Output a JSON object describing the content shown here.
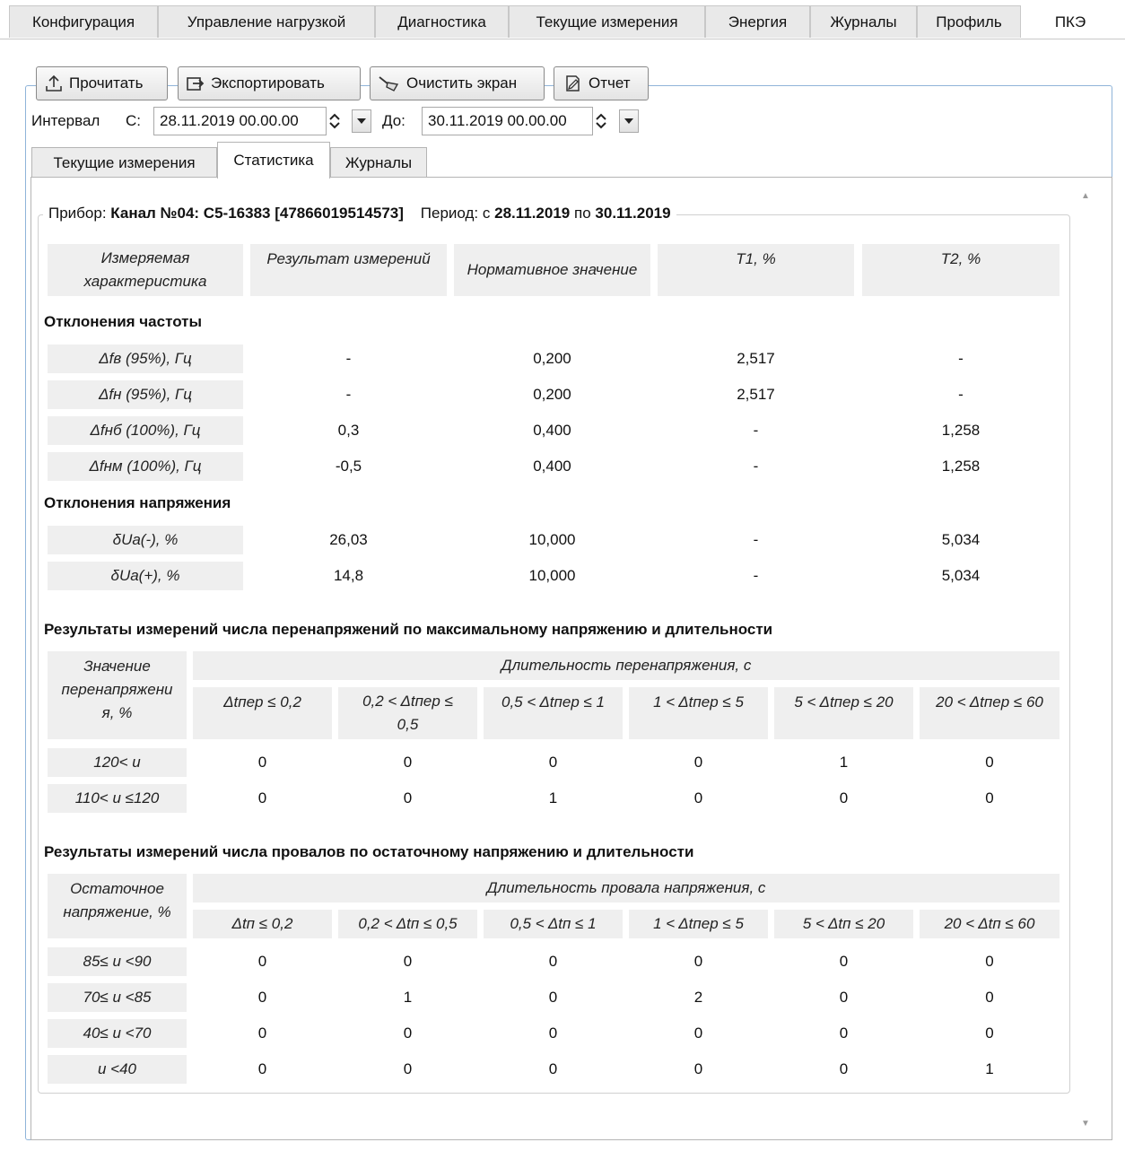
{
  "top_tabs": [
    "Конфигурация",
    "Управление нагрузкой",
    "Диагностика",
    "Текущие измерения",
    "Энергия",
    "Журналы",
    "Профиль",
    "ПКЭ"
  ],
  "toolbar": {
    "read": "Прочитать",
    "export": "Экспортировать",
    "clear": "Очистить экран",
    "report": "Отчет"
  },
  "interval": {
    "label": "Интервал",
    "from_label": "С:",
    "from_value": "28.11.2019 00.00.00",
    "to_label": "До:",
    "to_value": "30.11.2019 00.00.00"
  },
  "sub_tabs": [
    "Текущие измерения",
    "Статистика",
    "Журналы"
  ],
  "report": {
    "device_label": "Прибор:",
    "device_value": "Канал №04: C5-16383 [47866019514573]",
    "period_label": "Период: с",
    "period_from": "28.11.2019",
    "period_mid": "по",
    "period_to": "30.11.2019",
    "headers": [
      "Измеряемая характеристика",
      "Результат измерений",
      "Нормативное значение",
      "T1, %",
      "T2, %"
    ],
    "freq_section": "Отклонения частоты",
    "freq_rows": [
      {
        "name": "Δfв (95%), Гц",
        "result": "-",
        "norm": "0,200",
        "t1": "2,517",
        "t2": "-"
      },
      {
        "name": "Δfн (95%), Гц",
        "result": "-",
        "norm": "0,200",
        "t1": "2,517",
        "t2": "-"
      },
      {
        "name": "Δfнб (100%), Гц",
        "result": "0,3",
        "norm": "0,400",
        "t1": "-",
        "t2": "1,258"
      },
      {
        "name": "Δfнм (100%), Гц",
        "result": "-0,5",
        "norm": "0,400",
        "t1": "-",
        "t2": "1,258"
      }
    ],
    "volt_section": "Отклонения напряжения",
    "volt_rows": [
      {
        "name": "δUa(-), %",
        "result": "26,03",
        "norm": "10,000",
        "t1": "-",
        "t2": "5,034"
      },
      {
        "name": "δUa(+), %",
        "result": "14,8",
        "norm": "10,000",
        "t1": "-",
        "t2": "5,034"
      }
    ],
    "over_section": "Результаты измерений числа перенапряжений по максимальному напряжению и длительности",
    "over_row_header": "Значение перенапряжени я, %",
    "over_group_header": "Длительность перенапряжения, с",
    "over_cols": [
      "Δtпер ≤ 0,2",
      "0,2 < Δtпер ≤ 0,5",
      "0,5 < Δtпер ≤ 1",
      "1 < Δtпер ≤ 5",
      "5 < Δtпер ≤ 20",
      "20 < Δtпер ≤ 60"
    ],
    "over_rows": [
      {
        "name": "120< u",
        "values": [
          "0",
          "0",
          "0",
          "0",
          "1",
          "0"
        ]
      },
      {
        "name": "110< u ≤120",
        "values": [
          "0",
          "0",
          "1",
          "0",
          "0",
          "0"
        ]
      }
    ],
    "dip_section": "Результаты измерений числа провалов по остаточному напряжению и длительности",
    "dip_row_header": "Остаточное напряжение, %",
    "dip_group_header": "Длительность провала напряжения, с",
    "dip_cols": [
      "Δtп ≤ 0,2",
      "0,2 < Δtп ≤ 0,5",
      "0,5 < Δtп ≤ 1",
      "1 < Δtпер ≤ 5",
      "5 < Δtп ≤ 20",
      "20 < Δtп ≤ 60"
    ],
    "dip_rows": [
      {
        "name": "85≤ u <90",
        "values": [
          "0",
          "0",
          "0",
          "0",
          "0",
          "0"
        ]
      },
      {
        "name": "70≤ u <85",
        "values": [
          "0",
          "1",
          "0",
          "2",
          "0",
          "0"
        ]
      },
      {
        "name": "40≤ u <70",
        "values": [
          "0",
          "0",
          "0",
          "0",
          "0",
          "0"
        ]
      },
      {
        "name": "u <40",
        "values": [
          "0",
          "0",
          "0",
          "0",
          "0",
          "1"
        ]
      }
    ]
  }
}
